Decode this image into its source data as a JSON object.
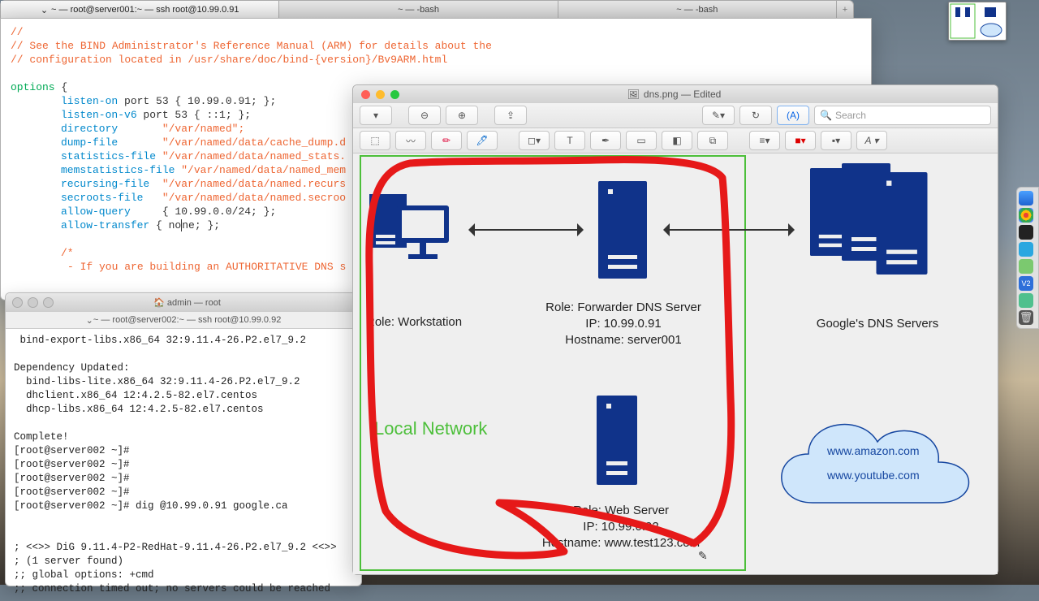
{
  "tabs": {
    "t1": "~ — root@server001:~ — ssh root@10.99.0.91",
    "t2": "~ — -bash",
    "t3": "~ — -bash"
  },
  "term1": {
    "c1": "//",
    "c2": "// See the BIND Administrator's Reference Manual (ARM) for details about the",
    "c3": "// configuration located in /usr/share/doc/bind-{version}/Bv9ARM.html",
    "kw": "options",
    "brace": " {",
    "l1a": "listen-on",
    "l1b": " port 53 { 10.99.0.91; };",
    "l2a": "listen-on-v6",
    "l2b": " port 53 { ::1; };",
    "l3a": "directory",
    "l3b": "       \"/var/named\";",
    "l4a": "dump-file",
    "l4b": "       \"/var/named/data/cache_dump.d",
    "l5a": "statistics-file",
    "l5b": " \"/var/named/data/named_stats.",
    "l6a": "memstatistics-file",
    "l6b": " \"/var/named/data/named_mem",
    "l7a": "recursing-file",
    "l7b": "  \"/var/named/data/named.recurs",
    "l8a": "secroots-file",
    "l8b": "   \"/var/named/data/named.secroo",
    "l9a": "allow-query",
    "l9b": "     { 10.99.0.0/24; };",
    "l10a": "allow-transfer",
    "l10b": " { no",
    "l10c": "ne; };",
    "cm1": "/*",
    "cm2": " - If you are building an AUTHORITATIVE DNS s"
  },
  "term2": {
    "title": "admin — root",
    "tab": "~ — root@server002:~ — ssh root@10.99.0.92",
    "body": " bind-export-libs.x86_64 32:9.11.4-26.P2.el7_9.2\n\nDependency Updated:\n  bind-libs-lite.x86_64 32:9.11.4-26.P2.el7_9.2\n  dhclient.x86_64 12:4.2.5-82.el7.centos\n  dhcp-libs.x86_64 12:4.2.5-82.el7.centos\n\nComplete!\n[root@server002 ~]#\n[root@server002 ~]#\n[root@server002 ~]#\n[root@server002 ~]#\n[root@server002 ~]# dig @10.99.0.91 google.ca\n\n\n; <<>> DiG 9.11.4-P2-RedHat-9.11.4-26.P2.el7_9.2 <<>>\n; (1 server found)\n;; global options: +cmd\n;; connection timed out; no servers could be reached"
  },
  "preview": {
    "title": "dns.png — Edited",
    "search_ph": "Search",
    "labels": {
      "ws": "Role: Workstation",
      "fwd1": "Role: Forwarder DNS Server",
      "fwd2": "IP: 10.99.0.91",
      "fwd3": "Hostname: server001",
      "google": "Google's DNS Servers",
      "web1": "Role: Web Server",
      "web2": "IP: 10.99.0.92",
      "web3": "Hostname: www.test123.com",
      "localnet": "Local Network",
      "cloud1": "www.amazon.com",
      "cloud2": "www.youtube.com"
    }
  },
  "icons": {
    "view": "▾",
    "zoomout": "⊖",
    "zoomin": "⊕",
    "share": "⇪",
    "pen": "✎",
    "crop": "⛶",
    "aA": "(A)",
    "search": "🔍",
    "sel": "⬚",
    "lasso": "〰",
    "pen2": "✏",
    "marker": "🖊",
    "shapes": "◻▾",
    "text": "T",
    "sign": "✒",
    "note": "▭",
    "fill": "◧",
    "mask": "⧉",
    "line": "≡▾",
    "clr": "■▾",
    "dash": "▪▾",
    "font": "A ▾"
  }
}
